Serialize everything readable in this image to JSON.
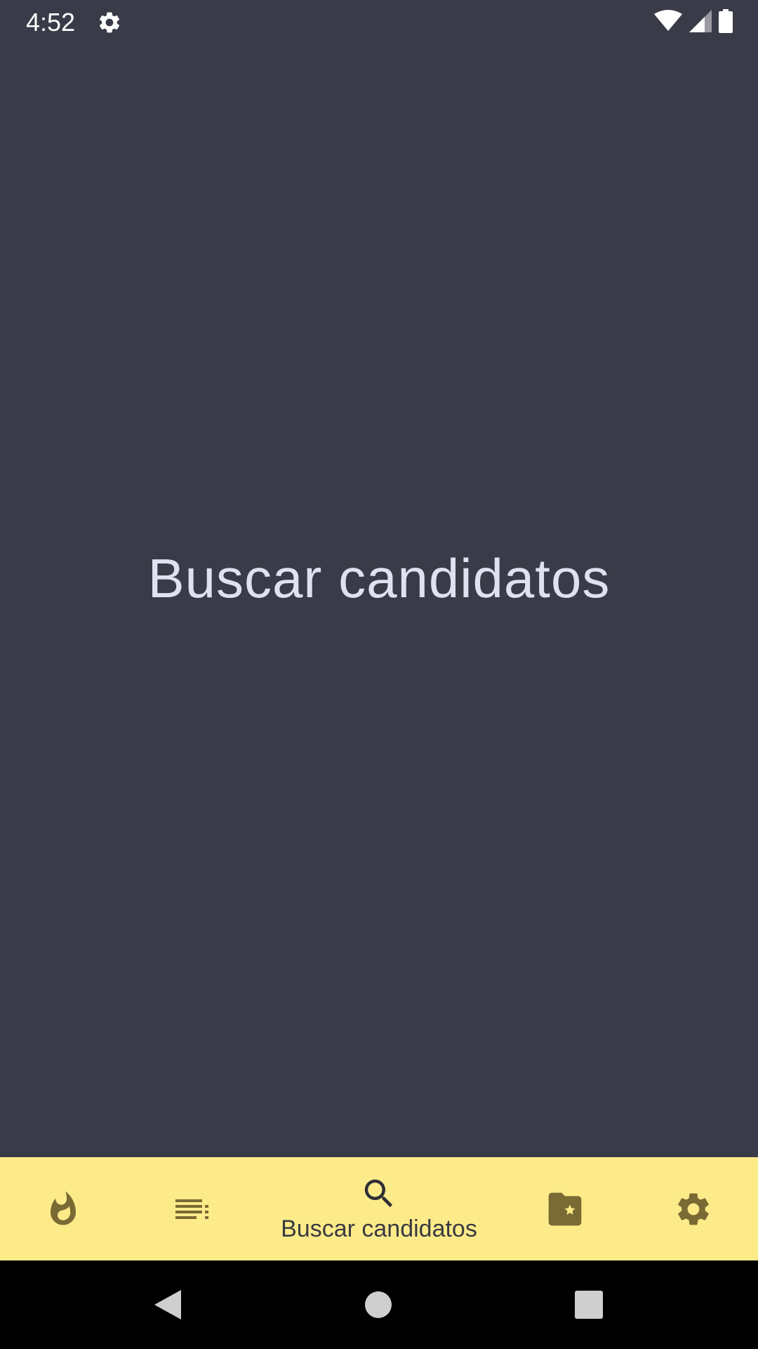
{
  "status_bar": {
    "time": "4:52",
    "icons": [
      "settings-icon",
      "wifi-icon",
      "cell-signal-icon",
      "battery-icon"
    ]
  },
  "main": {
    "title": "Buscar candidatos"
  },
  "bottom_nav": {
    "items": [
      {
        "icon": "fire-icon",
        "label": ""
      },
      {
        "icon": "list-icon",
        "label": ""
      },
      {
        "icon": "search-icon",
        "label": "Buscar candidatos",
        "selected": true
      },
      {
        "icon": "folder-star-icon",
        "label": ""
      },
      {
        "icon": "gear-icon",
        "label": ""
      }
    ],
    "background": "#fdeb8a",
    "icon_color": "#7a6a33"
  },
  "system_nav": {
    "buttons": [
      "back-icon",
      "home-icon",
      "recents-icon"
    ]
  },
  "colors": {
    "background": "#393c48",
    "title_text": "#e0e0f0"
  }
}
